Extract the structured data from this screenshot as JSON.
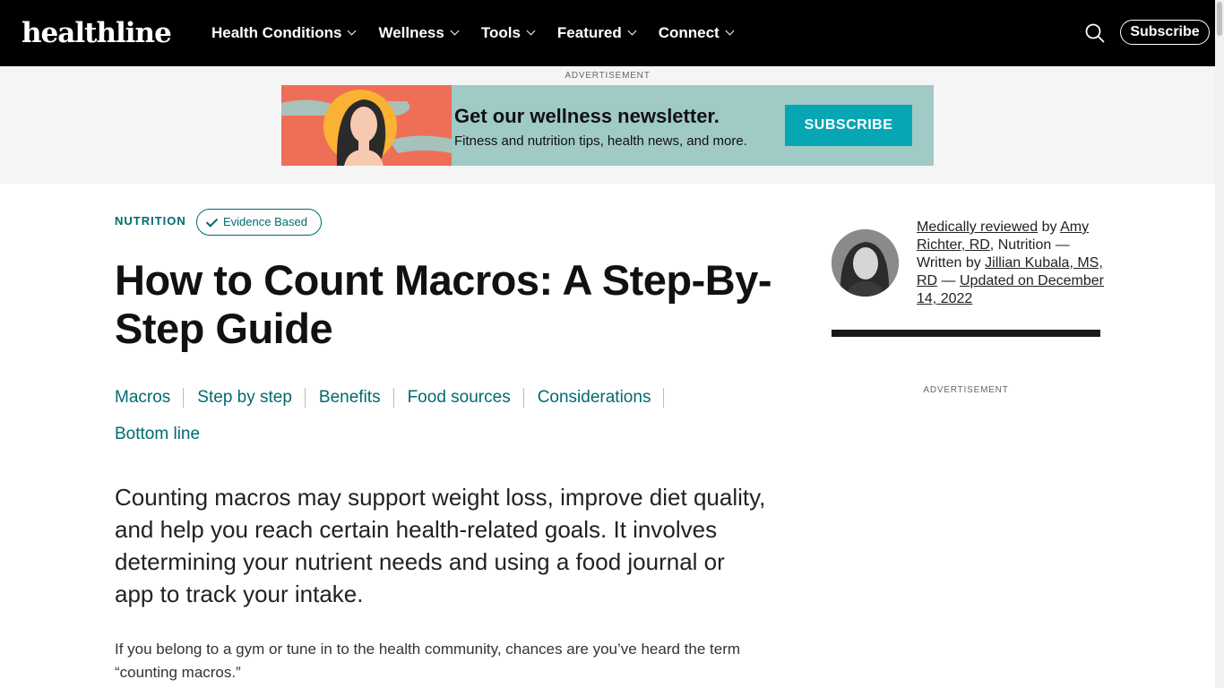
{
  "header": {
    "logo": "healthline",
    "nav": [
      {
        "label": "Health Conditions"
      },
      {
        "label": "Wellness"
      },
      {
        "label": "Tools"
      },
      {
        "label": "Featured"
      },
      {
        "label": "Connect"
      }
    ],
    "search_icon": "search-icon",
    "subscribe_label": "Subscribe"
  },
  "ad": {
    "label": "ADVERTISEMENT",
    "headline": "Get our wellness newsletter.",
    "subtext": "Fitness and nutrition tips, health news, and more.",
    "button": "SUBSCRIBE",
    "colors": {
      "background": "#9fcac6",
      "art": "#ef6e57",
      "button": "#06a6b5"
    }
  },
  "article": {
    "category": "NUTRITION",
    "badge": "Evidence Based",
    "title": "How to Count Macros: A Step-By-Step Guide",
    "toc": [
      {
        "label": "Macros"
      },
      {
        "label": "Step by step"
      },
      {
        "label": "Benefits"
      },
      {
        "label": "Food sources"
      },
      {
        "label": "Considerations"
      },
      {
        "label": "Bottom line"
      }
    ],
    "lede": "Counting macros may support weight loss, improve diet quality, and help you reach certain health-related goals. It involves determining your nutrient needs and using a food journal or app to track your intake.",
    "body": "If you belong to a gym or tune in to the health community, chances are you’ve heard the term “counting macros.”"
  },
  "sidebar": {
    "byline": {
      "reviewed_link": "Medically reviewed",
      "by1": " by ",
      "reviewer": "Amy Richter, RD",
      "mid": ", Nutrition — Written by ",
      "author": "Jillian Kubala, MS, RD",
      "dash": " — ",
      "updated": "Updated on December 14, 2022"
    },
    "ad_label": "ADVERTISEMENT"
  },
  "colors": {
    "brand_teal": "#006a70",
    "nav_bg": "#000000"
  }
}
